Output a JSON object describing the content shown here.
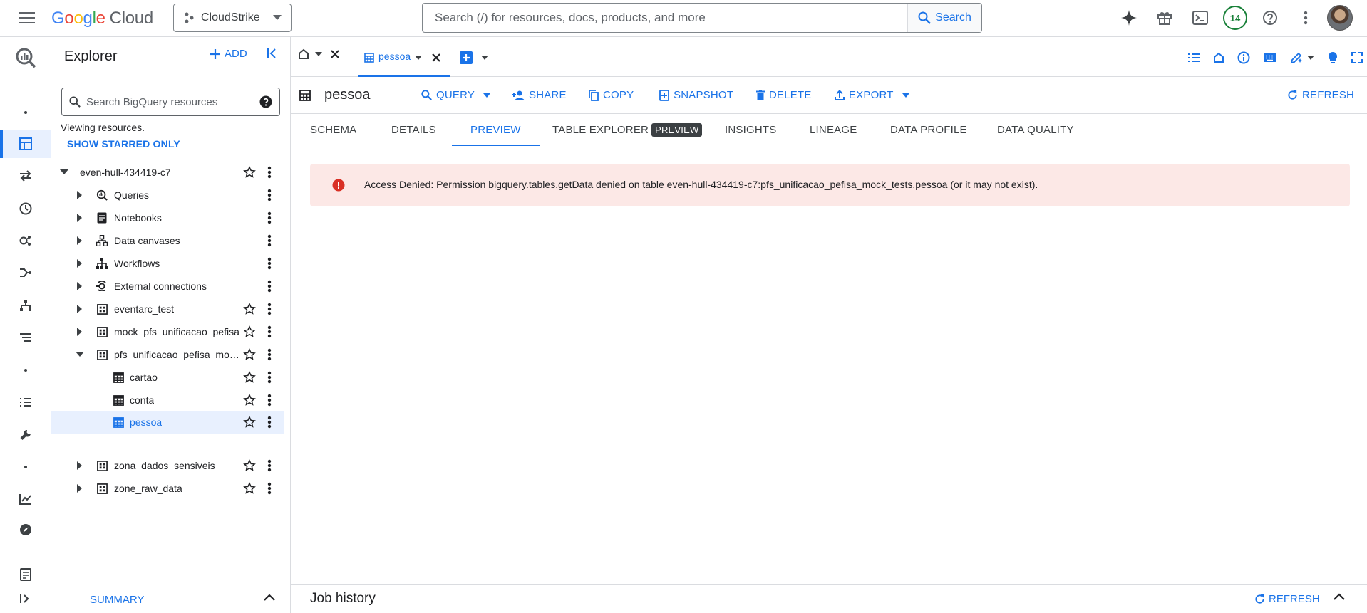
{
  "topbar": {
    "logo_google": "Google",
    "logo_cloud": "Cloud",
    "project_name": "CloudStrike",
    "search_placeholder": "Search (/) for resources, docs, products, and more",
    "search_button": "Search",
    "notification_count": "14"
  },
  "explorer": {
    "title": "Explorer",
    "add_label": "ADD",
    "search_placeholder": "Search BigQuery resources",
    "viewing_text": "Viewing resources.",
    "starred_link": "SHOW STARRED ONLY",
    "project": "even-hull-434419-c7",
    "items": [
      {
        "label": "Queries",
        "icon": "queries-icon"
      },
      {
        "label": "Notebooks",
        "icon": "notebook-icon"
      },
      {
        "label": "Data canvases",
        "icon": "data-canvas-icon"
      },
      {
        "label": "Workflows",
        "icon": "workflow-icon"
      },
      {
        "label": "External connections",
        "icon": "connection-icon"
      },
      {
        "label": "eventarc_test",
        "icon": "dataset-icon"
      },
      {
        "label": "mock_pfs_unificacao_pefisa",
        "icon": "dataset-icon"
      },
      {
        "label": "pfs_unificacao_pefisa_moc...",
        "icon": "dataset-icon"
      },
      {
        "label": "zona_dados_sensiveis",
        "icon": "dataset-icon"
      },
      {
        "label": "zone_raw_data",
        "icon": "dataset-icon"
      }
    ],
    "tables": [
      {
        "label": "cartao"
      },
      {
        "label": "conta"
      },
      {
        "label": "pessoa"
      }
    ],
    "summary_label": "SUMMARY"
  },
  "tabs": {
    "open_tab_label": "pessoa"
  },
  "toolbar": {
    "table_name": "pessoa",
    "query": "QUERY",
    "share": "SHARE",
    "copy": "COPY",
    "snapshot": "SNAPSHOT",
    "delete": "DELETE",
    "export": "EXPORT",
    "refresh": "REFRESH"
  },
  "subtabs": {
    "schema": "SCHEMA",
    "details": "DETAILS",
    "preview": "PREVIEW",
    "table_explorer": "TABLE EXPLORER",
    "table_explorer_chip": "PREVIEW",
    "insights": "INSIGHTS",
    "lineage": "LINEAGE",
    "data_profile": "DATA PROFILE",
    "data_quality": "DATA QUALITY"
  },
  "error": {
    "message": "Access Denied: Permission bigquery.tables.getData denied on table even-hull-434419-c7:pfs_unificacao_pefisa_mock_tests.pessoa (or it may not exist)."
  },
  "job_history": {
    "title": "Job history",
    "refresh": "REFRESH"
  },
  "colors": {
    "accent": "#1a73e8",
    "error_bg": "#fce8e6",
    "error_icon": "#d93025",
    "badge_green": "#188038"
  }
}
